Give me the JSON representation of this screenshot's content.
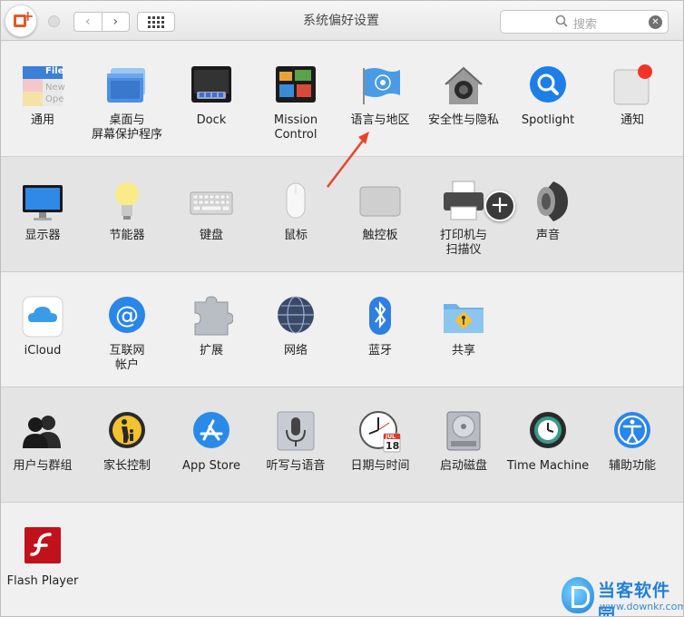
{
  "window": {
    "title": "系统偏好设置",
    "search_placeholder": "搜索",
    "nav_back": "‹",
    "nav_forward": "›",
    "clear_glyph": "✕"
  },
  "rows": [
    [
      {
        "id": "general",
        "label": "通用",
        "icon": "general-icon",
        "icon_text": "File",
        "icon_text2": "New",
        "icon_text3": "Ope"
      },
      {
        "id": "desktop",
        "label": "桌面与",
        "label2": "屏幕保护程序",
        "icon": "desktop-icon"
      },
      {
        "id": "dock",
        "label": "Dock",
        "icon": "dock-icon"
      },
      {
        "id": "mission",
        "label": "Mission",
        "label2": "Control",
        "icon": "mission-control-icon"
      },
      {
        "id": "language",
        "label": "语言与地区",
        "icon": "un-flag-icon"
      },
      {
        "id": "security",
        "label": "安全性与隐私",
        "icon": "security-house-icon"
      },
      {
        "id": "spotlight",
        "label": "Spotlight",
        "icon": "spotlight-icon"
      },
      {
        "id": "notifications",
        "label": "通知",
        "icon": "notifications-icon"
      }
    ],
    [
      {
        "id": "displays",
        "label": "显示器",
        "icon": "display-icon"
      },
      {
        "id": "energy",
        "label": "节能器",
        "icon": "lightbulb-icon"
      },
      {
        "id": "keyboard",
        "label": "键盘",
        "icon": "keyboard-icon"
      },
      {
        "id": "mouse",
        "label": "鼠标",
        "icon": "mouse-icon"
      },
      {
        "id": "trackpad",
        "label": "触控板",
        "icon": "trackpad-icon"
      },
      {
        "id": "printers",
        "label": "打印机与",
        "label2": "扫描仪",
        "icon": "printer-icon"
      },
      {
        "id": "sound",
        "label": "声音",
        "icon": "speaker-icon"
      }
    ],
    [
      {
        "id": "icloud",
        "label": "iCloud",
        "icon": "icloud-icon"
      },
      {
        "id": "internet",
        "label": "互联网",
        "label2": "帐户",
        "icon": "at-sign-icon"
      },
      {
        "id": "extensions",
        "label": "扩展",
        "icon": "puzzle-icon"
      },
      {
        "id": "network",
        "label": "网络",
        "icon": "globe-icon"
      },
      {
        "id": "bluetooth",
        "label": "蓝牙",
        "icon": "bluetooth-icon"
      },
      {
        "id": "sharing",
        "label": "共享",
        "icon": "sharing-folder-icon"
      }
    ],
    [
      {
        "id": "users",
        "label": "用户与群组",
        "icon": "users-icon"
      },
      {
        "id": "parental",
        "label": "家长控制",
        "icon": "parental-controls-icon"
      },
      {
        "id": "appstore",
        "label": "App Store",
        "icon": "app-store-icon"
      },
      {
        "id": "dictation",
        "label": "听写与语音",
        "icon": "microphone-icon"
      },
      {
        "id": "datetime",
        "label": "日期与时间",
        "icon": "clock-calendar-icon",
        "icon_text": "JUL",
        "icon_text2": "18"
      },
      {
        "id": "startup",
        "label": "启动磁盘",
        "icon": "hard-disk-icon"
      },
      {
        "id": "timemachine",
        "label": "Time Machine",
        "icon": "time-machine-icon"
      },
      {
        "id": "accessibility",
        "label": "辅助功能",
        "icon": "accessibility-icon"
      }
    ],
    [
      {
        "id": "flash",
        "label": "Flash Player",
        "icon": "flash-player-icon"
      }
    ]
  ],
  "overlay": {
    "add_glyph": "+"
  },
  "watermark": {
    "brand": "当客软件园",
    "url": "www.downkr.com"
  }
}
